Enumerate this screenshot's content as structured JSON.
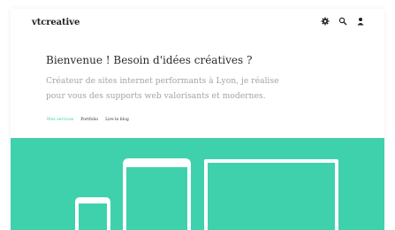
{
  "header": {
    "logo": "vtcreative",
    "icons": [
      "gear-icon",
      "search-icon",
      "user-icon"
    ]
  },
  "main": {
    "headline": "Bienvenue ! Besoin d'idées créatives ?",
    "intro_line1": "Créateur de sites internet performants à Lyon, je réalise",
    "intro_line2": "pour vous des supports web valorisants et modernes."
  },
  "nav": {
    "items": [
      {
        "label": "Mes services",
        "active": true
      },
      {
        "label": "Portfolio",
        "active": false
      },
      {
        "label": "Lire le blog",
        "active": false
      }
    ]
  },
  "hero": {
    "accent_color": "#3fd1ac",
    "devices": [
      "phone",
      "tablet",
      "laptop"
    ]
  }
}
